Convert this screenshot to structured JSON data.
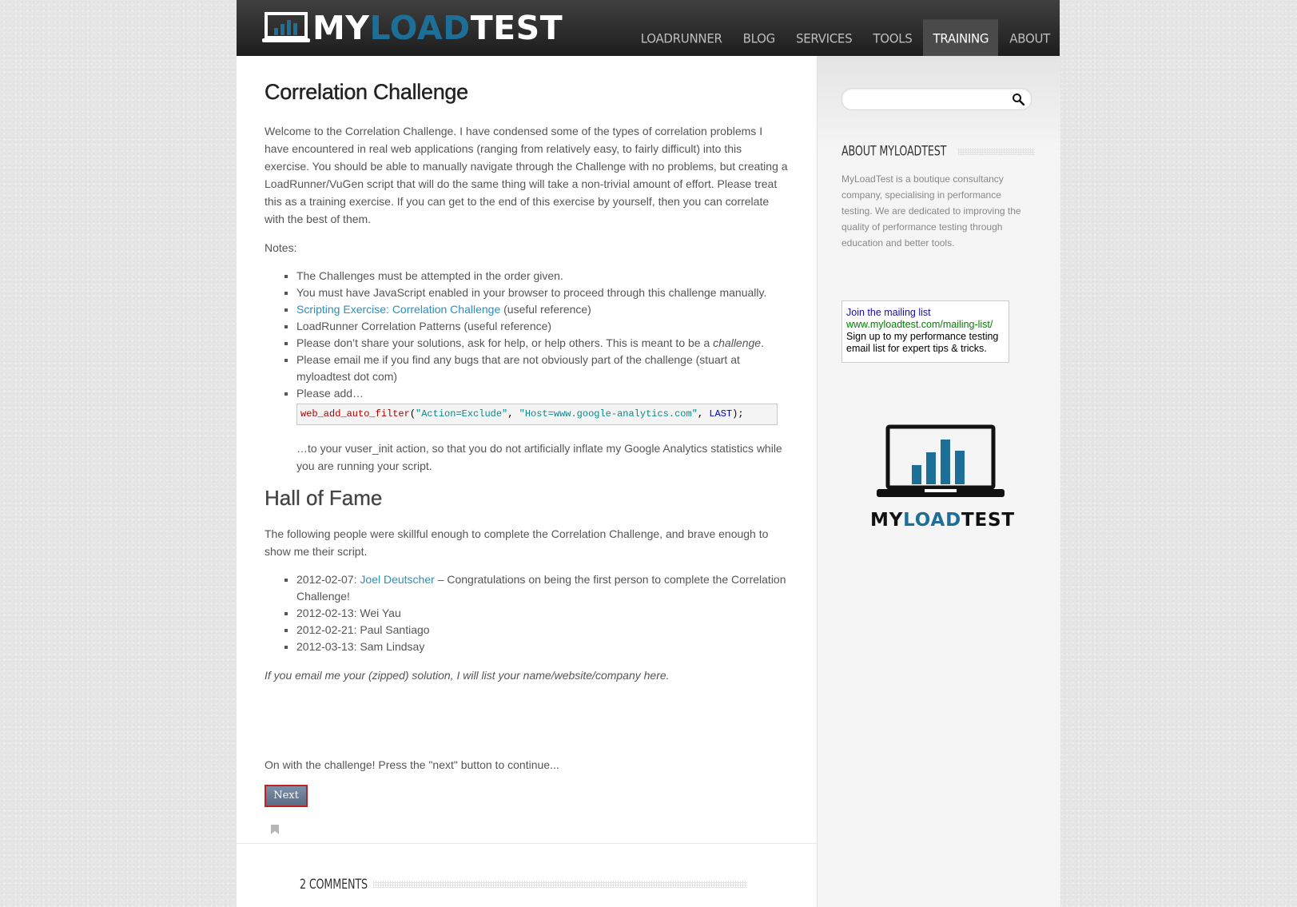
{
  "header": {
    "logo": {
      "part1": "MY",
      "part2": "LOAD",
      "part3": "TEST"
    },
    "nav": [
      {
        "label": "LOADRUNNER",
        "active": false
      },
      {
        "label": "BLOG",
        "active": false
      },
      {
        "label": "SERVICES",
        "active": false
      },
      {
        "label": "TOOLS",
        "active": false
      },
      {
        "label": "TRAINING",
        "active": true
      },
      {
        "label": "ABOUT",
        "active": false
      }
    ]
  },
  "article": {
    "title": "Correlation Challenge",
    "intro": "Welcome to the Correlation Challenge. I have condensed some of the types of correlation problems I have encountered in real web applications (ranging from relatively easy, to fairly difficult) into this exercise. You should be able to manually navigate through the Challenge with no problems, but creating a LoadRunner/VuGen script that will do the same thing will take a non-trivial amount of effort. Please treat this as a training exercise. If you can get to the end of this exercise by yourself, then you can correlate with the best of them.",
    "notes_label": "Notes:",
    "notes": {
      "n1": "The Challenges must be attempted in the order given.",
      "n2": "You must have JavaScript enabled in your browser to proceed through this challenge manually.",
      "n3_link": "Scripting Exercise: Correlation Challenge",
      "n3_rest": " (useful reference)",
      "n4": "LoadRunner Correlation Patterns (useful reference)",
      "n5_pre": "Please don’t share your solutions, ask for help, or help others. This is meant to be a ",
      "n5_em": "challenge",
      "n5_post": ".",
      "n6": "Please email me if you find any bugs that are not obviously part of the challenge (stuart at myloadtest dot com)",
      "n7_pre": "Please add…",
      "code": {
        "fn": "web_add_auto_filter",
        "open": "(",
        "s1": "\"Action=Exclude\"",
        "comma1": ", ",
        "s2": "\"Host=www.google-analytics.com\"",
        "comma2": ", ",
        "kw": "LAST",
        "close": ");"
      },
      "n7_post": "…to your vuser_init action, so that you do not artificially inflate my Google Analytics statistics while you are running your script."
    },
    "hof_title": "Hall of Fame",
    "hof_intro": "The following people were skillful enough to complete the Correlation Challenge, and brave enough to show me their script.",
    "hof": {
      "e1_date": "2012-02-07: ",
      "e1_link": "Joel Deutscher",
      "e1_rest": " – Congratulations on being the first person to complete the Correlation Challenge!",
      "e2": "2012-02-13: Wei Yau",
      "e3": "2012-02-21: Paul Santiago",
      "e4": "2012-03-13: Sam Lindsay"
    },
    "hof_note": "If you email me your (zipped) solution, I will list your name/website/company here.",
    "continue_text": "On with the challenge! Press the \"next\" button to continue...",
    "next_label": "Next",
    "comments_heading": "2 COMMENTS"
  },
  "sidebar": {
    "search_placeholder": "",
    "about_heading": "ABOUT MYLOADTEST",
    "about_text": "MyLoadTest is a boutique consultancy company, specialising in performance testing. We are dedicated to improving the quality of performance testing through education and better tools.",
    "mailing": {
      "title": "Join the mailing list",
      "url": "www.myloadtest.com/mailing-list/",
      "desc": "Sign up to my performance testing email list for expert tips & tricks."
    },
    "logo": {
      "part1": "MY",
      "part2": "LOAD",
      "part3": "TEST"
    }
  },
  "colors": {
    "accent": "#1e6f98",
    "link": "#2a8fbd",
    "header_dark": "#1d1d1d"
  }
}
